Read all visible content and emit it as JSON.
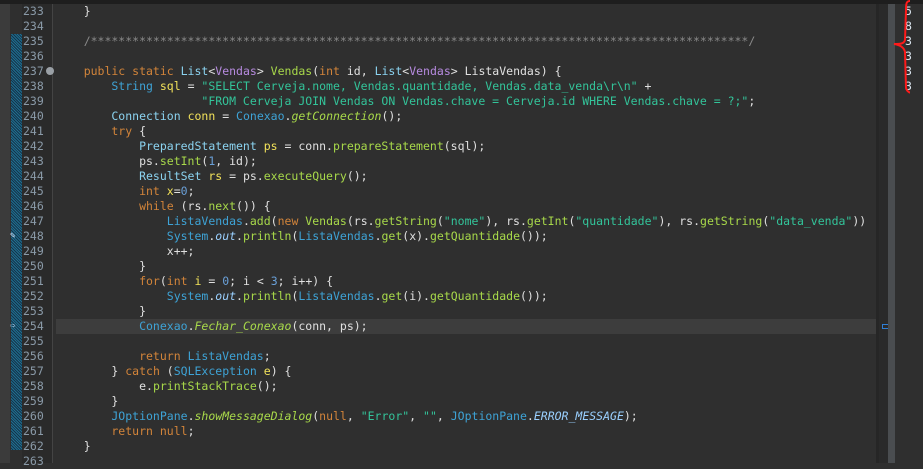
{
  "editor": {
    "lines": [
      {
        "num": "233",
        "tokens": [
          [
            "d",
            "    }"
          ]
        ]
      },
      {
        "num": "234",
        "tokens": []
      },
      {
        "num": "235",
        "tokens": [
          [
            "cm",
            "    /***********************************************************************************************/"
          ]
        ]
      },
      {
        "num": "236",
        "tokens": []
      },
      {
        "num": "237",
        "tokens": [
          [
            "k",
            "    public static "
          ],
          [
            "t",
            "List"
          ],
          [
            "d",
            "<"
          ],
          [
            "g",
            "Vendas"
          ],
          [
            "d",
            "> "
          ],
          [
            "m",
            "Vendas"
          ],
          [
            "d",
            "("
          ],
          [
            "k",
            "int "
          ],
          [
            "d",
            "id, "
          ],
          [
            "t",
            "List"
          ],
          [
            "d",
            "<"
          ],
          [
            "g",
            "Vendas"
          ],
          [
            "d",
            "> "
          ],
          [
            "d",
            "ListaVendas) {"
          ]
        ]
      },
      {
        "num": "238",
        "tokens": [
          [
            "c",
            "        String "
          ],
          [
            "v",
            "sql"
          ],
          [
            "d",
            " = "
          ],
          [
            "s",
            "\"SELECT Cerveja.nome, Vendas.quantidade, Vendas.data_venda\\r\\n\""
          ],
          [
            "d",
            " +"
          ]
        ]
      },
      {
        "num": "239",
        "tokens": [
          [
            "s",
            "                     \"FROM Cerveja JOIN Vendas ON Vendas.chave = Cerveja.id WHERE Vendas.chave = ?;\""
          ],
          [
            "d",
            ";"
          ]
        ]
      },
      {
        "num": "240",
        "tokens": [
          [
            "t",
            "        Connection "
          ],
          [
            "v",
            "conn"
          ],
          [
            "d",
            " = "
          ],
          [
            "c",
            "Conexao"
          ],
          [
            "d",
            "."
          ],
          [
            "mi",
            "getConnection"
          ],
          [
            "d",
            "();"
          ]
        ]
      },
      {
        "num": "241",
        "tokens": [
          [
            "k",
            "        try"
          ],
          [
            "d",
            " {"
          ]
        ]
      },
      {
        "num": "242",
        "tokens": [
          [
            "t",
            "            PreparedStatement "
          ],
          [
            "v",
            "ps"
          ],
          [
            "d",
            " = conn."
          ],
          [
            "m",
            "prepareStatement"
          ],
          [
            "d",
            "(sql);"
          ]
        ]
      },
      {
        "num": "243",
        "tokens": [
          [
            "d",
            "            ps."
          ],
          [
            "m",
            "setInt"
          ],
          [
            "d",
            "("
          ],
          [
            "n",
            "1"
          ],
          [
            "d",
            ", id);"
          ]
        ]
      },
      {
        "num": "244",
        "tokens": [
          [
            "t",
            "            ResultSet "
          ],
          [
            "v",
            "rs"
          ],
          [
            "d",
            " = ps."
          ],
          [
            "m",
            "executeQuery"
          ],
          [
            "d",
            "();"
          ]
        ]
      },
      {
        "num": "245",
        "tokens": [
          [
            "k",
            "            int "
          ],
          [
            "v",
            "x"
          ],
          [
            "d",
            "="
          ],
          [
            "n",
            "0"
          ],
          [
            "d",
            ";"
          ]
        ]
      },
      {
        "num": "246",
        "tokens": [
          [
            "k",
            "            while"
          ],
          [
            "d",
            " (rs."
          ],
          [
            "m",
            "next"
          ],
          [
            "d",
            "()) {"
          ]
        ]
      },
      {
        "num": "247",
        "tokens": [
          [
            "c",
            "                ListaVendas"
          ],
          [
            "d",
            "."
          ],
          [
            "m",
            "add"
          ],
          [
            "d",
            "("
          ],
          [
            "k",
            "new "
          ],
          [
            "m",
            "Vendas"
          ],
          [
            "d",
            "(rs."
          ],
          [
            "m",
            "getString"
          ],
          [
            "d",
            "("
          ],
          [
            "s",
            "\"nome\""
          ],
          [
            "d",
            "), rs."
          ],
          [
            "m",
            "getInt"
          ],
          [
            "d",
            "("
          ],
          [
            "s",
            "\"quantidade\""
          ],
          [
            "d",
            "), rs."
          ],
          [
            "m",
            "getString"
          ],
          [
            "d",
            "("
          ],
          [
            "s",
            "\"data_venda\""
          ],
          [
            "d",
            "))"
          ]
        ]
      },
      {
        "num": "248",
        "tokens": [
          [
            "c",
            "                System"
          ],
          [
            "d",
            "."
          ],
          [
            "f",
            "out"
          ],
          [
            "d",
            "."
          ],
          [
            "m",
            "println"
          ],
          [
            "d",
            "("
          ],
          [
            "c",
            "ListaVendas"
          ],
          [
            "d",
            "."
          ],
          [
            "m",
            "get"
          ],
          [
            "d",
            "(x)."
          ],
          [
            "m",
            "getQuantidade"
          ],
          [
            "d",
            "());"
          ]
        ]
      },
      {
        "num": "249",
        "tokens": [
          [
            "d",
            "                x++;"
          ]
        ]
      },
      {
        "num": "250",
        "tokens": [
          [
            "d",
            "            }"
          ]
        ]
      },
      {
        "num": "251",
        "tokens": [
          [
            "k",
            "            for"
          ],
          [
            "d",
            "("
          ],
          [
            "k",
            "int "
          ],
          [
            "v",
            "i"
          ],
          [
            "d",
            " = "
          ],
          [
            "n",
            "0"
          ],
          [
            "d",
            "; i < "
          ],
          [
            "n",
            "3"
          ],
          [
            "d",
            "; i++) {"
          ]
        ]
      },
      {
        "num": "252",
        "tokens": [
          [
            "c",
            "                System"
          ],
          [
            "d",
            "."
          ],
          [
            "f",
            "out"
          ],
          [
            "d",
            "."
          ],
          [
            "m",
            "println"
          ],
          [
            "d",
            "("
          ],
          [
            "c",
            "ListaVendas"
          ],
          [
            "d",
            "."
          ],
          [
            "m",
            "get"
          ],
          [
            "d",
            "(i)."
          ],
          [
            "m",
            "getQuantidade"
          ],
          [
            "d",
            "());"
          ]
        ]
      },
      {
        "num": "253",
        "tokens": [
          [
            "d",
            "            }"
          ]
        ]
      },
      {
        "num": "254",
        "tokens": [
          [
            "c",
            "            Conexao"
          ],
          [
            "d",
            "."
          ],
          [
            "mi",
            "Fechar_Conexao"
          ],
          [
            "d",
            "(conn, ps);"
          ]
        ]
      },
      {
        "num": "255",
        "tokens": []
      },
      {
        "num": "256",
        "tokens": [
          [
            "k",
            "            return "
          ],
          [
            "c",
            "ListaVendas"
          ],
          [
            "d",
            ";"
          ]
        ]
      },
      {
        "num": "257",
        "tokens": [
          [
            "d",
            "        } "
          ],
          [
            "k",
            "catch "
          ],
          [
            "d",
            "("
          ],
          [
            "c",
            "SQLException "
          ],
          [
            "v",
            "e"
          ],
          [
            "d",
            ") {"
          ]
        ]
      },
      {
        "num": "258",
        "tokens": [
          [
            "d",
            "            e."
          ],
          [
            "m",
            "printStackTrace"
          ],
          [
            "d",
            "();"
          ]
        ]
      },
      {
        "num": "259",
        "tokens": [
          [
            "d",
            "        }"
          ]
        ]
      },
      {
        "num": "260",
        "tokens": [
          [
            "c",
            "        JOptionPane"
          ],
          [
            "d",
            "."
          ],
          [
            "mi",
            "showMessageDialog"
          ],
          [
            "d",
            "("
          ],
          [
            "k",
            "null"
          ],
          [
            "d",
            ", "
          ],
          [
            "s",
            "\"Error\""
          ],
          [
            "d",
            ", "
          ],
          [
            "s",
            "\"\""
          ],
          [
            "d",
            ", "
          ],
          [
            "c",
            "JOptionPane"
          ],
          [
            "d",
            "."
          ],
          [
            "f",
            "ERROR_MESSAGE"
          ],
          [
            "d",
            ");"
          ]
        ]
      },
      {
        "num": "261",
        "tokens": [
          [
            "k",
            "        return null"
          ],
          [
            "d",
            ";"
          ]
        ]
      },
      {
        "num": "262",
        "tokens": [
          [
            "d",
            "    }"
          ]
        ]
      },
      {
        "num": "263",
        "tokens": []
      }
    ],
    "current_line": "254",
    "fold_line": "237",
    "breakpoint_line": "248"
  },
  "output": {
    "values": [
      "5",
      "8",
      "3",
      "3",
      "3",
      "3"
    ]
  },
  "colors": {
    "background": "#2f2f2f",
    "keyword": "#d2843a",
    "string": "#33c49a",
    "annotation": "#ff0000"
  }
}
